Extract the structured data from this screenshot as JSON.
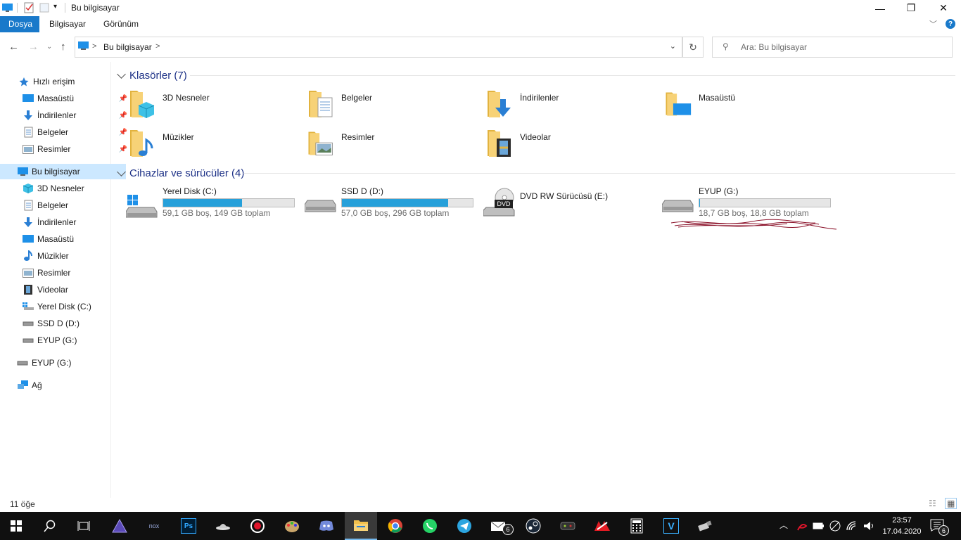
{
  "window": {
    "title": "Bu bilgisayar",
    "controls": {
      "minimize": "—",
      "maximize": "❐",
      "close": "✕"
    }
  },
  "ribbon": {
    "tabs": [
      "Dosya",
      "Bilgisayar",
      "Görünüm"
    ],
    "help": "?"
  },
  "address": {
    "path": "Bu bilgisayar",
    "separator": ">",
    "search_placeholder": "Ara: Bu bilgisayar"
  },
  "sidebar": {
    "quick_access": "Hızlı erişim",
    "quick_items": [
      "Masaüstü",
      "İndirilenler",
      "Belgeler",
      "Resimler"
    ],
    "this_pc": "Bu bilgisayar",
    "pc_items": [
      "3D Nesneler",
      "Belgeler",
      "İndirilenler",
      "Masaüstü",
      "Müzikler",
      "Resimler",
      "Videolar",
      "Yerel Disk (C:)",
      "SSD D (D:)",
      "EYUP (G:)"
    ],
    "usb": "EYUP (G:)",
    "network": "Ağ"
  },
  "folders_group": {
    "title": "Klasörler (7)",
    "items": [
      "3D Nesneler",
      "Belgeler",
      "İndirilenler",
      "Masaüstü",
      "Müzikler",
      "Resimler",
      "Videolar"
    ]
  },
  "drives_group": {
    "title": "Cihazlar ve sürücüler (4)",
    "items": [
      {
        "name": "Yerel Disk (C:)",
        "size": "59,1 GB boş, 149 GB toplam",
        "used_fraction": 0.6
      },
      {
        "name": "SSD D (D:)",
        "size": "57,0 GB boş, 296 GB toplam",
        "used_fraction": 0.81
      },
      {
        "name": "DVD RW Sürücüsü (E:)",
        "size": "",
        "used_fraction": null
      },
      {
        "name": "EYUP (G:)",
        "size": "18,7 GB boş, 18,8 GB toplam",
        "used_fraction": 0.005
      }
    ]
  },
  "status": {
    "count": "11 öğe"
  },
  "taskbar": {
    "time": "23:57",
    "date": "17.04.2020",
    "notification_count": "6",
    "mail_badge": "6",
    "icons": [
      "windows-icon",
      "search-icon",
      "task-view-icon",
      "prism-icon",
      "nox-icon",
      "photoshop-icon",
      "hat-icon",
      "record-icon",
      "paint-icon",
      "discord-icon",
      "file-explorer-icon",
      "chrome-icon",
      "whatsapp-icon",
      "telegram-icon",
      "mail-icon",
      "steam-icon",
      "game-icon",
      "msi-icon",
      "calculator-icon",
      "v-app-icon",
      "usb-icon"
    ]
  },
  "colors": {
    "accent": "#1979ca",
    "progress": "#26a0da",
    "selected": "#cce8ff",
    "header": "#1e3287"
  }
}
